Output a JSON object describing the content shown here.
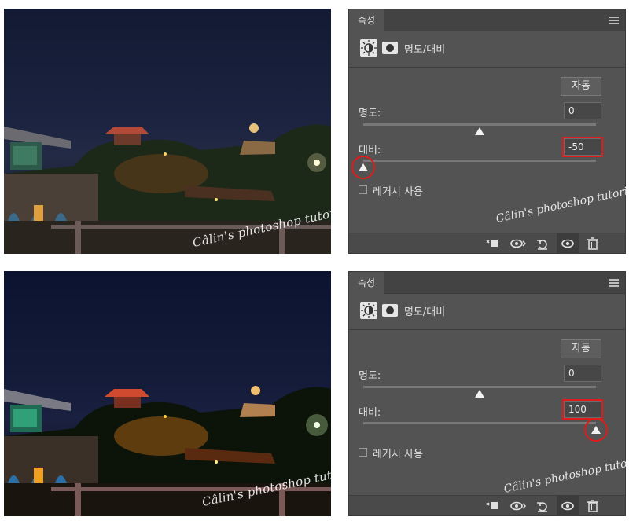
{
  "watermark": "Câlin's photoshop tutorial",
  "panels": [
    {
      "tab_label": "속성",
      "title": "명도/대비",
      "auto_label": "자동",
      "brightness_label": "명도:",
      "brightness_value": "0",
      "brightness_level": 0.5,
      "contrast_label": "대비:",
      "contrast_value": "-50",
      "contrast_level": 0.0,
      "legacy_label": "레거시 사용"
    },
    {
      "tab_label": "속성",
      "title": "명도/대비",
      "auto_label": "자동",
      "brightness_label": "명도:",
      "brightness_value": "0",
      "brightness_level": 0.5,
      "contrast_label": "대비:",
      "contrast_value": "100",
      "contrast_level": 1.0,
      "legacy_label": "레거시 사용"
    }
  ],
  "colors": {
    "highlight": "#e01b1b",
    "panel_bg": "#535353",
    "sky": "#1b2340"
  },
  "footer_icons": [
    "clip-to-layer-icon",
    "view-previous-icon",
    "reset-icon",
    "visibility-eye-icon",
    "delete-trash-icon"
  ]
}
